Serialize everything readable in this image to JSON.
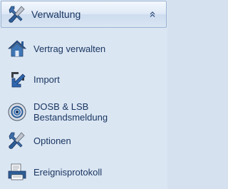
{
  "header": {
    "title": "Verwaltung",
    "icon": "tools-icon",
    "collapse_icon": "double-chevron-up-icon"
  },
  "items": [
    {
      "label": "Vertrag verwalten",
      "icon": "house-icon"
    },
    {
      "label": "Import",
      "icon": "import-arrow-icon"
    },
    {
      "label_line1": "DOSB & LSB",
      "label_line2": "Bestandsmeldung",
      "icon": "radio-signal-icon"
    },
    {
      "label": "Optionen",
      "icon": "tools-icon"
    },
    {
      "label": "Ereignisprotokoll",
      "icon": "log-printer-icon"
    }
  ],
  "colors": {
    "text": "#17345f",
    "panel": "#dbe6f3",
    "header_border": "#9bb3d2"
  }
}
